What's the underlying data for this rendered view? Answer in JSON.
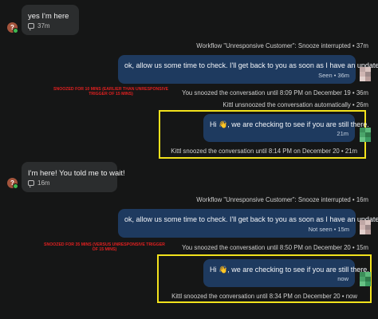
{
  "messages": {
    "m1": {
      "text": "yes I'm here",
      "time": "37m"
    },
    "e1": "Workflow \"Unresponsive Customer\": Snooze interrupted • 37m",
    "m2": {
      "text": "ok, allow us some time to check. I'll get back to you as soon as I have an update.",
      "status": "Seen • 36m"
    },
    "note1": [
      "SNOOZED FOR 10 MINS (EARLIER THAN UNRESPONSIVE",
      "TRIGGER OF 15 MINS)"
    ],
    "e2": "You snoozed the conversation until 8:09 PM on December 19 • 36m",
    "e3": "Kittl unsnoozed the conversation automatically • 26m",
    "m3": {
      "text": "Hi 👋, we are checking to see if you are still there.",
      "time": "21m"
    },
    "e4": "Kittl snoozed the conversation until 8:14 PM on December 20 • 21m",
    "m4": {
      "text": "I'm here! You told me to wait!",
      "time": "16m"
    },
    "e5": "Workflow \"Unresponsive Customer\": Snooze interrupted • 16m",
    "m5": {
      "text": "ok, allow us some time to check. I'll get back to you as soon as I have an update.",
      "status": "Not seen • 15m"
    },
    "note2": [
      "SNOOZED FOR 35 MINS (VERSUS UNRESPONSIVE TRIGGER",
      "OF 15 MINS)"
    ],
    "e6": "You snoozed the conversation until 8:50 PM on December 20 • 15m",
    "m6": {
      "text": "Hi 👋, we are checking to see if you are still there.",
      "time": "now"
    },
    "e7": "Kittl snoozed the conversation until 8:34 PM on December 20 • now"
  },
  "avatar_initial": "?",
  "colors": {
    "highlight": "#f2e21c",
    "note": "#e02020",
    "outgoing": "#1e3a5f",
    "incoming": "#2b2d2e"
  }
}
